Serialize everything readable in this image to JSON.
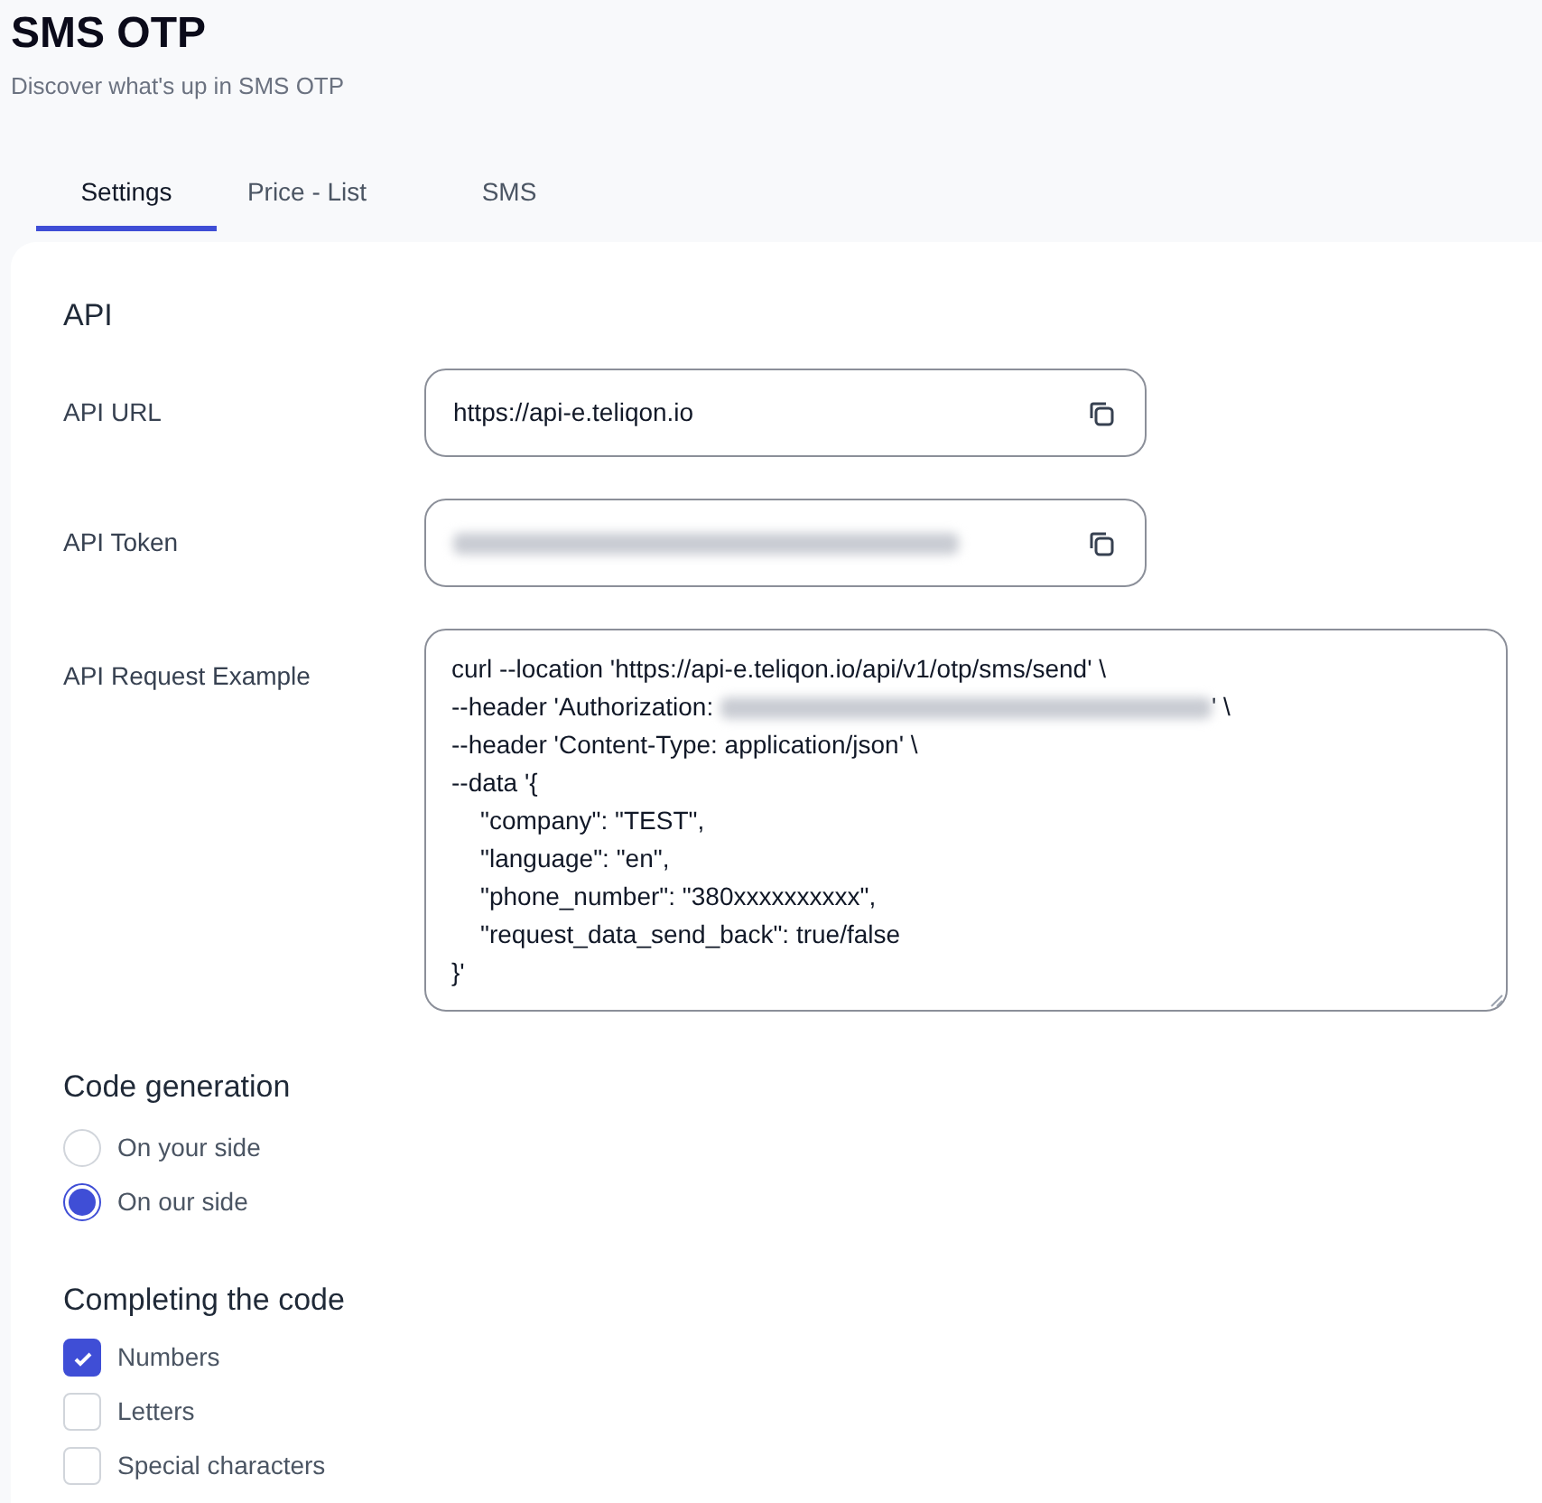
{
  "header": {
    "title": "SMS OTP",
    "subtitle": "Discover what's up in SMS OTP"
  },
  "tabs": [
    {
      "label": "Settings",
      "selected": true
    },
    {
      "label": "Price - List",
      "selected": false
    },
    {
      "label": "SMS",
      "selected": false
    }
  ],
  "api": {
    "heading": "API",
    "url": {
      "label": "API URL",
      "value": "https://api-e.teliqon.io",
      "redacted": false
    },
    "token": {
      "label": "API Token",
      "redacted": true
    },
    "example": {
      "label": "API Request Example",
      "lines": [
        {
          "kind": "plain",
          "text": "curl --location 'https://api-e.teliqon.io/api/v1/otp/sms/send' \\"
        },
        {
          "kind": "redacted",
          "text": "--header 'Authorization: ",
          "after": "' \\"
        },
        {
          "kind": "plain",
          "text": "--header 'Content-Type: application/json' \\"
        },
        {
          "kind": "plain",
          "text": "--data '{"
        },
        {
          "kind": "indented",
          "text": "\"company\": \"TEST\","
        },
        {
          "kind": "indented",
          "text": "\"language\": \"en\","
        },
        {
          "kind": "indented",
          "text": "\"phone_number\": \"380xxxxxxxxxx\","
        },
        {
          "kind": "indented",
          "text": "\"request_data_send_back\": true/false"
        },
        {
          "kind": "plain",
          "text": "}'"
        }
      ]
    }
  },
  "code_generation": {
    "heading": "Code generation",
    "options": [
      {
        "label": "On your side",
        "selected": false
      },
      {
        "label": "On our side",
        "selected": true
      }
    ]
  },
  "completing": {
    "heading": "Completing the code",
    "options": [
      {
        "label": "Numbers",
        "checked": true
      },
      {
        "label": "Letters",
        "checked": false
      },
      {
        "label": "Special characters",
        "checked": false
      }
    ]
  }
}
